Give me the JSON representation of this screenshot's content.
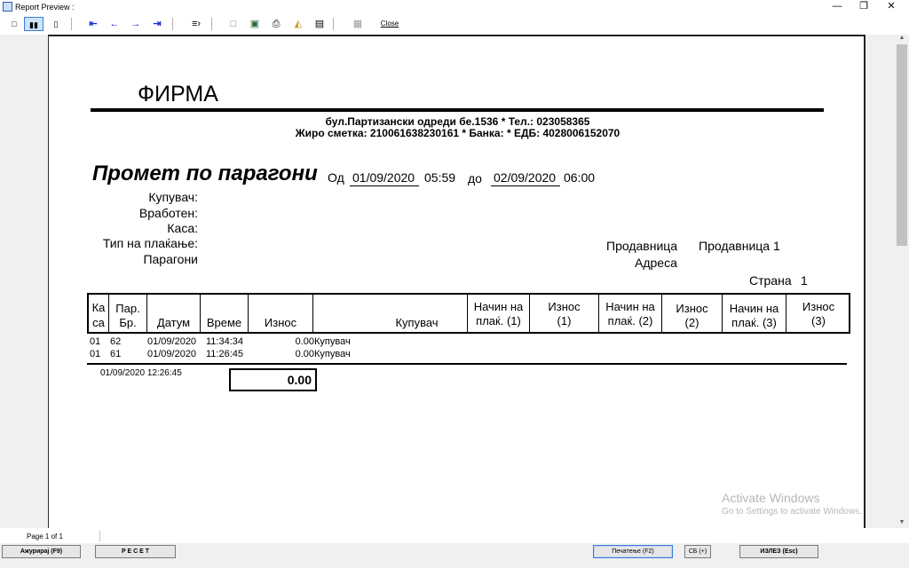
{
  "window": {
    "title": "Report Preview :"
  },
  "toolbar": {
    "close_label": "Close"
  },
  "report": {
    "company": "ФИРМА",
    "address_line": "бул.Партизански одреди бе.1536 * Тел.: 023058365",
    "account_line": "Жиро сметка: 210061638230161 * Банка:  * ЕДБ: 4028006152070",
    "title": "Промет по парагони",
    "from_label": "Од",
    "from_date": "01/09/2020",
    "from_time": "05:59",
    "to_label": "до",
    "to_date": "02/09/2020",
    "to_time": "06:00",
    "filters": [
      "Купувач:",
      "Вработен:",
      "Каса:",
      "Тип на плаќање:",
      "Парагони"
    ],
    "store_label": "Продавница",
    "store_value": "Продавница 1",
    "address_label": "Адреса",
    "page_label": "Страна",
    "page_number": "1",
    "columns": {
      "kasa_1": "Ка",
      "kasa_2": "са",
      "par_1": "Пар.",
      "par_2": "Бр.",
      "datum": "Датум",
      "vreme": "Време",
      "iznos": "Износ",
      "kupuvac": "Купувач",
      "nacin1_1": "Начин на",
      "nacin1_2": "плаќ. (1)",
      "iznos1_1": "Износ",
      "iznos1_2": "(1)",
      "nacin2_1": "Начин на",
      "nacin2_2": "плаќ. (2)",
      "iznos2_1": "Износ",
      "iznos2_2": "(2)",
      "nacin3_1": "Начин на",
      "nacin3_2": "плаќ. (3)",
      "iznos3_1": "Износ",
      "iznos3_2": "(3)"
    },
    "rows": [
      {
        "kasa": "01",
        "par": "62",
        "datum": "01/09/2020",
        "vreme": "11:34:34",
        "iznos": "0.00",
        "kupuvac": "Купувач"
      },
      {
        "kasa": "01",
        "par": "61",
        "datum": "01/09/2020",
        "vreme": "11:26:45",
        "iznos": "0.00",
        "kupuvac": "Купувач"
      }
    ],
    "printed_at": "01/09/2020 12:26:45",
    "total": "0.00"
  },
  "watermark": {
    "line1": "Activate Windows",
    "line2": "Go to Settings to activate Windows."
  },
  "statusbar": {
    "page_info": "Page 1 of 1"
  },
  "buttons": {
    "update": "Ажурирај (F9)",
    "reset": "Р Е С Е Т",
    "print": "Печатење (F2)",
    "sb": "СБ (+)",
    "exit": "ИЗЛЕЗ (Esc)"
  },
  "colors": {
    "accent_arrow": "#1a2fd0",
    "focus_border": "#3b7ad9"
  }
}
